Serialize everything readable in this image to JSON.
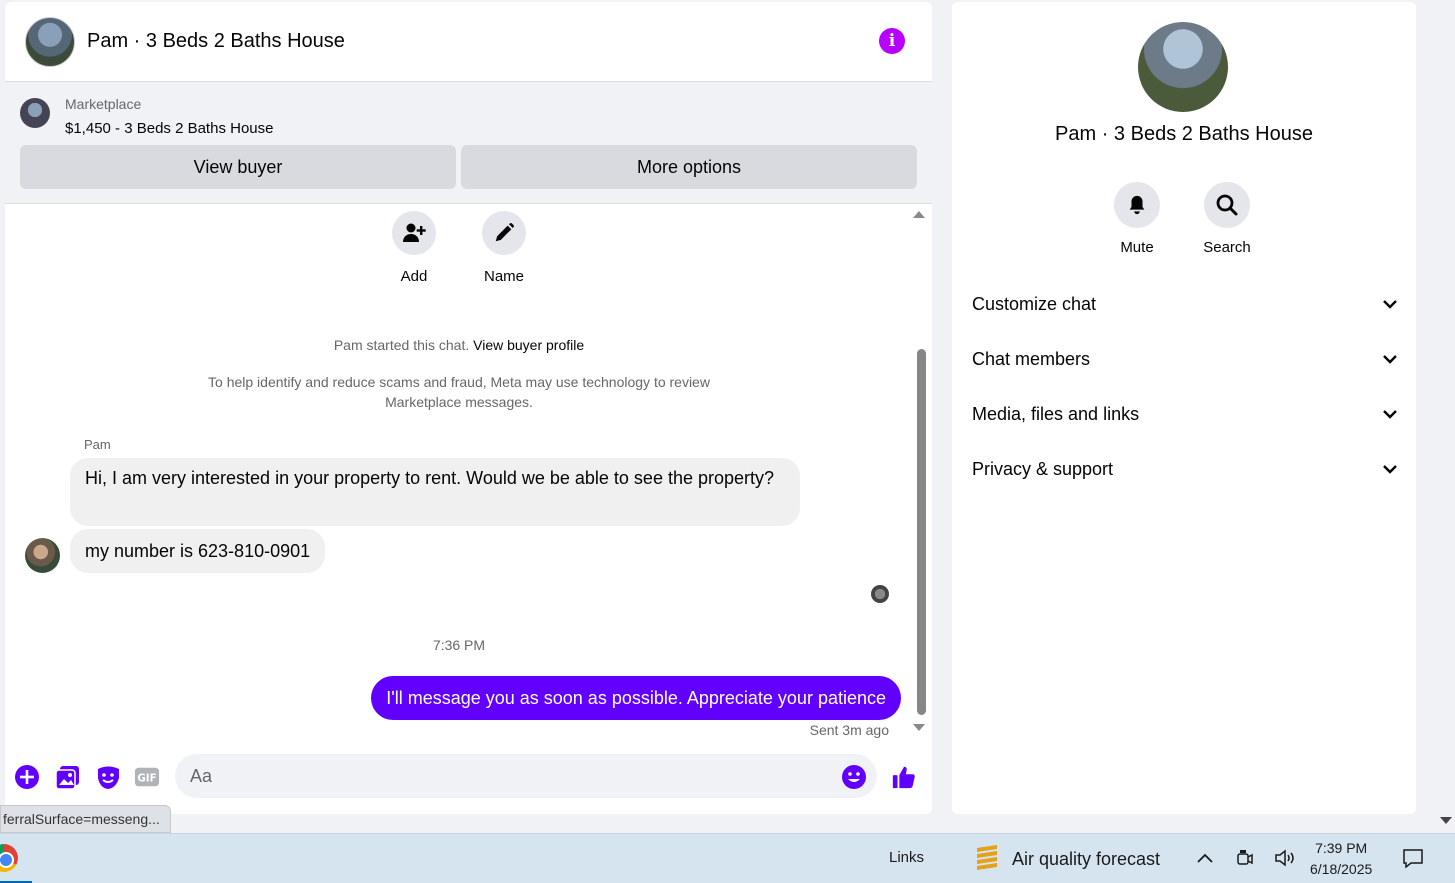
{
  "chat": {
    "title": "Pam · 3 Beds 2 Baths House",
    "marketplace_label": "Marketplace",
    "listing": "$1,450 - 3 Beds 2 Baths House",
    "view_buyer_label": "View buyer",
    "more_options_label": "More options",
    "actions": [
      {
        "label": "Add",
        "icon": "add-person-icon"
      },
      {
        "label": "Name",
        "icon": "pencil-icon"
      }
    ],
    "started_text": "Pam started this chat.",
    "view_profile_link": "View buyer profile",
    "notice": "To help identify and reduce scams and fraud, Meta may use technology to review Marketplace messages.",
    "sender_name": "Pam",
    "incoming_messages": [
      "Hi, I am very interested in your property to rent. Would we be able to see the property?",
      "my number is 623-810-0901"
    ],
    "timestamp": "7:36 PM",
    "outgoing_message": "I'll message you as soon as possible. Appreciate your patience",
    "sent_status": "Sent 3m ago",
    "composer_placeholder": "Aa",
    "accent_color": "#6200ff"
  },
  "info_panel": {
    "title": "Pam · 3 Beds 2 Baths House",
    "quick_actions": [
      {
        "label": "Mute",
        "icon": "bell-icon"
      },
      {
        "label": "Search",
        "icon": "search-icon"
      }
    ],
    "sections": [
      "Customize chat",
      "Chat members",
      "Media, files and links",
      "Privacy & support"
    ]
  },
  "status_url": "ferralSurface=messeng...",
  "taskbar": {
    "links_label": "Links",
    "weather_label": "Air quality forecast",
    "time": "7:39 PM",
    "date": "6/18/2025"
  }
}
